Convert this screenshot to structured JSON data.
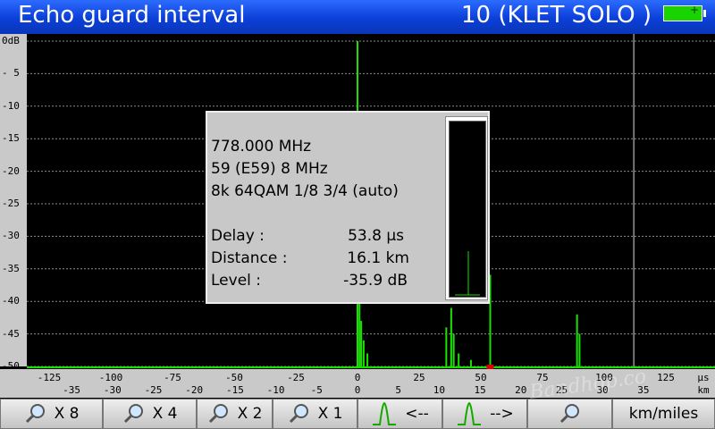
{
  "title": "Echo guard interval",
  "channel": "10 (KLET SOLO )",
  "colors": {
    "title_bg": "#0b3fd8",
    "trace": "#19e000",
    "battery": "#19d400",
    "marker": "#e00000"
  },
  "y_labels": [
    "0dB",
    "- 5",
    "-10",
    "-15",
    "-20",
    "-25",
    "-30",
    "-35",
    "-40",
    "-45",
    "-50"
  ],
  "x_us_labels": [
    "-125",
    "-100",
    "-75",
    "-50",
    "-25",
    "0",
    "25",
    "50",
    "75",
    "100",
    "125"
  ],
  "x_us_unit": "µs",
  "x_km_labels": [
    "-35",
    "-30",
    "-25",
    "-20",
    "-15",
    "-10",
    "-5",
    "0",
    "5",
    "10",
    "15",
    "20",
    "25",
    "30",
    "35"
  ],
  "x_km_unit": "km",
  "info": {
    "line1": "778.000 MHz",
    "line2": "59 (E59)  8 MHz",
    "line3": "8k 64QAM 1/8 3/4 (auto)",
    "delay_label": "Delay :",
    "delay_value": "53.8 µs",
    "distance_label": "Distance :",
    "distance_value": "16.1 km",
    "level_label": "Level :",
    "level_value": "-35.9 dB"
  },
  "toolbar": {
    "zoom8": "X 8",
    "zoom4": "X 4",
    "zoom2": "X 2",
    "zoom1": "X 1",
    "prev": "<--",
    "next": "-->",
    "units": "km/miles"
  },
  "watermark": "Bandhop.co",
  "chart_data": {
    "type": "bar",
    "x_unit": "µs",
    "y_unit": "dB",
    "xlim": [
      -137,
      137
    ],
    "ylim": [
      -50,
      0
    ],
    "guard_interval_us": 112,
    "echoes": [
      {
        "x": 0,
        "y": 0
      },
      {
        "x": 0.8,
        "y": -40
      },
      {
        "x": 1.5,
        "y": -43
      },
      {
        "x": 2.5,
        "y": -46
      },
      {
        "x": 4,
        "y": -48
      },
      {
        "x": 36,
        "y": -44
      },
      {
        "x": 38,
        "y": -41
      },
      {
        "x": 39,
        "y": -45
      },
      {
        "x": 41,
        "y": -48
      },
      {
        "x": 46,
        "y": -49
      },
      {
        "x": 48,
        "y": -50
      },
      {
        "x": 53.8,
        "y": -35.9
      },
      {
        "x": 89,
        "y": -42
      },
      {
        "x": 90,
        "y": -45
      }
    ],
    "marker_us": 53.8
  }
}
